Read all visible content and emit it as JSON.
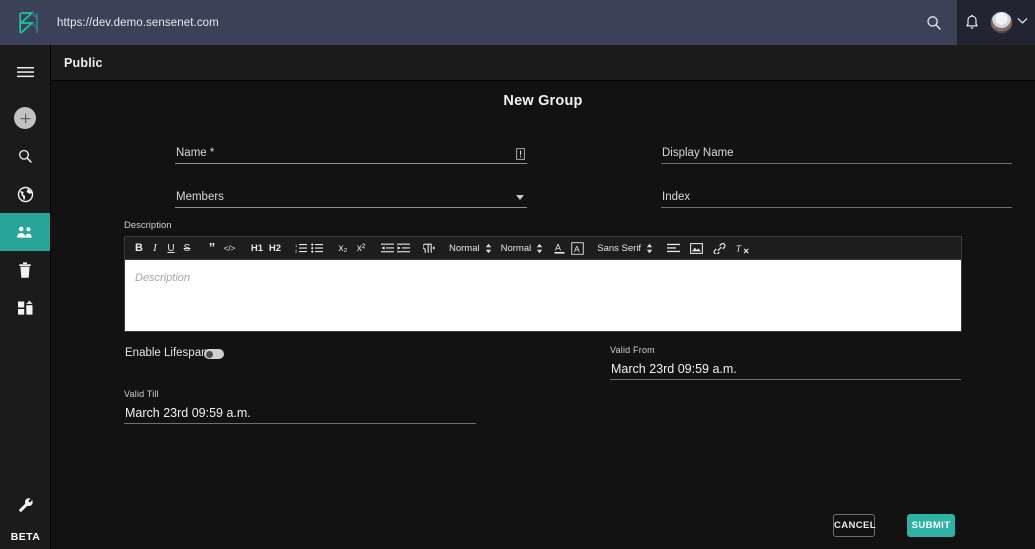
{
  "browser": {
    "url": "https://dev.demo.sensenet.com",
    "logo_icon": "sensenet-logo-icon",
    "search_icon": "search-icon",
    "bell_icon": "notifications-bell-icon",
    "avatar_icon": "user-avatar",
    "chevron_icon": "chevron-down-icon"
  },
  "sidebar": {
    "items": [
      {
        "name": "menu-toggle",
        "icon": "hamburger-menu-icon",
        "active": false
      },
      {
        "name": "add",
        "icon": "plus-circle-icon",
        "active": false
      },
      {
        "name": "search",
        "icon": "search-icon",
        "active": false
      },
      {
        "name": "content-explorer",
        "icon": "globe-icon",
        "active": false
      },
      {
        "name": "users-and-groups",
        "icon": "users-group-icon",
        "active": true
      },
      {
        "name": "trash",
        "icon": "trash-icon",
        "active": false
      },
      {
        "name": "apps",
        "icon": "apps-grid-icon",
        "active": false
      }
    ],
    "bottom": {
      "setup_icon": "wrench-icon",
      "beta_label": "BETA"
    },
    "active_color": "#27a598"
  },
  "header": {
    "title": "Public"
  },
  "page": {
    "title": "New Group"
  },
  "form": {
    "name": {
      "label": "Name *",
      "value": "",
      "error_icon": "error-indicator-icon"
    },
    "display_name": {
      "label": "Display Name",
      "value": ""
    },
    "members": {
      "label": "Members",
      "value": "",
      "caret_icon": "dropdown-caret-icon"
    },
    "index": {
      "label": "Index",
      "value": ""
    },
    "description": {
      "label": "Description",
      "placeholder": "Description",
      "toolbar": [
        {
          "name": "bold",
          "icon": "bold-icon",
          "glyph": "B"
        },
        {
          "name": "italic",
          "icon": "italic-icon",
          "glyph": "I"
        },
        {
          "name": "underline",
          "icon": "underline-icon",
          "glyph": "U"
        },
        {
          "name": "strikethrough",
          "icon": "strikethrough-icon",
          "glyph": "S"
        },
        {
          "name": "blockquote",
          "icon": "blockquote-icon",
          "glyph": "”"
        },
        {
          "name": "code-block",
          "icon": "code-icon",
          "glyph": "</>"
        },
        {
          "name": "heading-1",
          "icon": "h1-icon",
          "glyph": "H1"
        },
        {
          "name": "heading-2",
          "icon": "h2-icon",
          "glyph": "H2"
        },
        {
          "name": "ordered-list",
          "icon": "ordered-list-icon",
          "glyph": ""
        },
        {
          "name": "bullet-list",
          "icon": "bullet-list-icon",
          "glyph": ""
        },
        {
          "name": "subscript",
          "icon": "subscript-icon",
          "glyph": "x₂"
        },
        {
          "name": "superscript",
          "icon": "superscript-icon",
          "glyph": "x²"
        },
        {
          "name": "outdent",
          "icon": "outdent-icon",
          "glyph": ""
        },
        {
          "name": "indent",
          "icon": "indent-icon",
          "glyph": ""
        },
        {
          "name": "text-direction",
          "icon": "text-direction-rtl-icon",
          "glyph": "¶"
        }
      ],
      "selects": [
        {
          "name": "size-select",
          "value": "Normal"
        },
        {
          "name": "header-select",
          "value": "Normal"
        },
        {
          "name": "font-select",
          "value": "Sans Serif"
        }
      ],
      "color_buttons": [
        {
          "name": "text-color",
          "icon": "text-color-icon",
          "glyph": "A"
        },
        {
          "name": "background-color",
          "icon": "background-color-icon",
          "glyph": "A"
        }
      ],
      "trailing": [
        {
          "name": "align",
          "icon": "align-icon"
        },
        {
          "name": "insert-image",
          "icon": "image-icon"
        },
        {
          "name": "insert-link",
          "icon": "link-icon"
        },
        {
          "name": "clear-formatting",
          "icon": "clear-formatting-icon"
        }
      ]
    },
    "enable_lifespan": {
      "label": "Enable Lifespan",
      "checked": false
    },
    "valid_from": {
      "label": "Valid From",
      "value": "March 23rd 09:59 a.m."
    },
    "valid_till": {
      "label": "Valid Till",
      "value": "March 23rd 09:59 a.m."
    }
  },
  "actions": {
    "cancel_label": "CANCEL",
    "submit_label": "SUBMIT",
    "submit_color": "#2cb3a3"
  }
}
